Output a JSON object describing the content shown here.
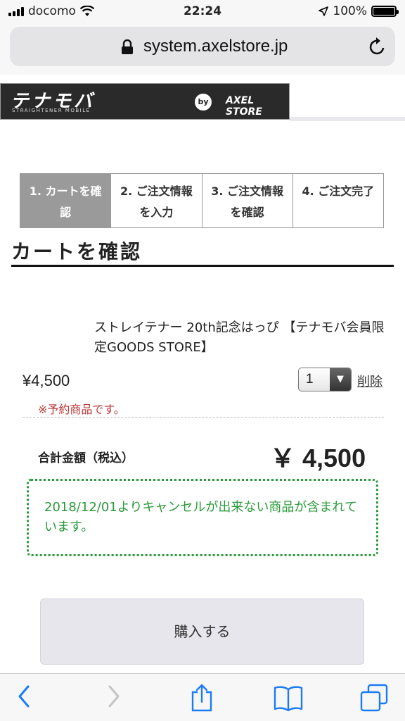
{
  "status_bar": {
    "carrier": "docomo",
    "time": "22:24",
    "battery": "100%"
  },
  "browser": {
    "url": "system.axelstore.jp"
  },
  "banner": {
    "logo_main": "テナモバ",
    "logo_sub": "STRAIGHTENER MOBILE",
    "by": "by",
    "partner": "AXEL STORE"
  },
  "steps": [
    {
      "label": "1. カートを確認",
      "active": true
    },
    {
      "label": "2. ご注文情報を入力",
      "active": false
    },
    {
      "label": "3. ご注文情報を確認",
      "active": false
    },
    {
      "label": "4. ご注文完了",
      "active": false
    }
  ],
  "page": {
    "title": "カートを確認"
  },
  "cart_item": {
    "name": "ストレイテナー 20th記念はっぴ 【テナモバ会員限定GOODS STORE】",
    "price": "¥4,500",
    "quantity": "1",
    "delete_label": "削除",
    "preorder_note": "※予約商品です。"
  },
  "total": {
    "label": "合計金額（税込）",
    "value": "￥ 4,500"
  },
  "notice": {
    "text": "2018/12/01よりキャンセルが出来ない商品が含まれています。"
  },
  "actions": {
    "purchase_label": "購入する"
  },
  "colors": {
    "accent_green": "#2a9a3a",
    "warning_red": "#b33333",
    "active_step": "#9a9a9a",
    "ios_blue": "#1a7cf5"
  }
}
